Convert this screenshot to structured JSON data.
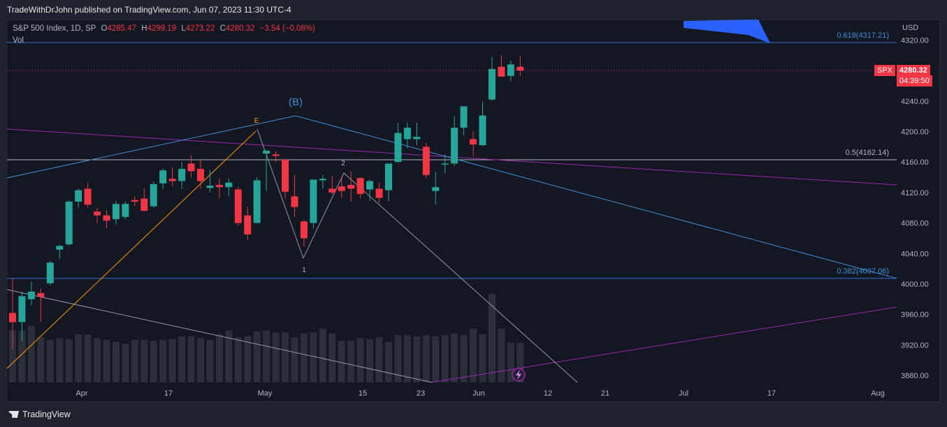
{
  "header": {
    "publish_line": "TradeWithDrJohn published on TradingView.com, Jun 07, 2023 11:30 UTC-4"
  },
  "legend": {
    "symbol": "S&P 500 Index, 1D, SP",
    "open_label": "O",
    "open": "4285.47",
    "high_label": "H",
    "high": "4299.19",
    "low_label": "L",
    "low": "4273.22",
    "close_label": "C",
    "close": "4280.32",
    "change": "−3.54 (−0.08%)",
    "volume_label": "Vol"
  },
  "price_axis": {
    "currency": "USD",
    "ticks": [
      "4320.00",
      "4240.00",
      "4200.00",
      "4160.00",
      "4120.00",
      "4080.00",
      "4040.00",
      "4000.00",
      "3960.00",
      "3920.00",
      "3880.00"
    ]
  },
  "time_axis": {
    "ticks": [
      "Apr",
      "17",
      "May",
      "15",
      "23",
      "Jun",
      "12",
      "21",
      "Jul",
      "17",
      "Aug"
    ]
  },
  "badges": {
    "symbol": "SPX",
    "last_price": "4280.32",
    "countdown": "04:39:50"
  },
  "annotations": {
    "fib_618": "0.618(4317.21)",
    "fib_5": "0.5(4162.14)",
    "fib_382": "0.382(4007.06)",
    "wave_b": "(B)",
    "wave_e": "E",
    "wave_1": "1",
    "wave_2": "2"
  },
  "footer": {
    "brand": "TradingView"
  },
  "colors": {
    "up": "#26a69a",
    "down": "#f23645",
    "background": "#131722",
    "fib_line": "#2962ff",
    "purple_line": "#9c27b0",
    "orange_line": "#ff9800"
  },
  "chart_data": {
    "type": "candlestick",
    "x_labels": [
      "Apr",
      "17",
      "May",
      "15",
      "23",
      "Jun",
      "12",
      "21",
      "Jul",
      "17",
      "Aug"
    ],
    "ylim": [
      3870,
      4330
    ],
    "candles": [
      {
        "o": 3962,
        "h": 4008,
        "l": 3915,
        "c": 3950
      },
      {
        "o": 3950,
        "h": 3990,
        "l": 3925,
        "c": 3984
      },
      {
        "o": 3980,
        "h": 4003,
        "l": 3972,
        "c": 3990
      },
      {
        "o": 3988,
        "h": 3994,
        "l": 3950,
        "c": 3983
      },
      {
        "o": 4001,
        "h": 4030,
        "l": 3998,
        "c": 4028
      },
      {
        "o": 4045,
        "h": 4052,
        "l": 4033,
        "c": 4050
      },
      {
        "o": 4052,
        "h": 4110,
        "l": 4050,
        "c": 4108
      },
      {
        "o": 4108,
        "h": 4125,
        "l": 4100,
        "c": 4123
      },
      {
        "o": 4125,
        "h": 4133,
        "l": 4100,
        "c": 4104
      },
      {
        "o": 4095,
        "h": 4100,
        "l": 4080,
        "c": 4090
      },
      {
        "o": 4090,
        "h": 4097,
        "l": 4073,
        "c": 4083
      },
      {
        "o": 4085,
        "h": 4109,
        "l": 4078,
        "c": 4105
      },
      {
        "o": 4088,
        "h": 4108,
        "l": 4085,
        "c": 4105
      },
      {
        "o": 4110,
        "h": 4115,
        "l": 4102,
        "c": 4108
      },
      {
        "o": 4112,
        "h": 4126,
        "l": 4095,
        "c": 4096
      },
      {
        "o": 4102,
        "h": 4134,
        "l": 4100,
        "c": 4131
      },
      {
        "o": 4132,
        "h": 4151,
        "l": 4125,
        "c": 4149
      },
      {
        "o": 4138,
        "h": 4153,
        "l": 4128,
        "c": 4135
      },
      {
        "o": 4135,
        "h": 4160,
        "l": 4125,
        "c": 4151
      },
      {
        "o": 4158,
        "h": 4169,
        "l": 4140,
        "c": 4148
      },
      {
        "o": 4151,
        "h": 4163,
        "l": 4125,
        "c": 4135
      },
      {
        "o": 4126,
        "h": 4150,
        "l": 4120,
        "c": 4129
      },
      {
        "o": 4130,
        "h": 4138,
        "l": 4112,
        "c": 4127
      },
      {
        "o": 4127,
        "h": 4138,
        "l": 4115,
        "c": 4133
      },
      {
        "o": 4124,
        "h": 4127,
        "l": 4076,
        "c": 4080
      },
      {
        "o": 4090,
        "h": 4101,
        "l": 4058,
        "c": 4065
      },
      {
        "o": 4080,
        "h": 4140,
        "l": 4080,
        "c": 4136
      },
      {
        "o": 4171,
        "h": 4173,
        "l": 4122,
        "c": 4175
      },
      {
        "o": 4170,
        "h": 4174,
        "l": 4160,
        "c": 4168
      },
      {
        "o": 4163,
        "h": 4164,
        "l": 4112,
        "c": 4121
      },
      {
        "o": 4115,
        "h": 4143,
        "l": 4088,
        "c": 4101
      },
      {
        "o": 4082,
        "h": 4084,
        "l": 4049,
        "c": 4060
      },
      {
        "o": 4080,
        "h": 4132,
        "l": 4073,
        "c": 4137
      },
      {
        "o": 4136,
        "h": 4143,
        "l": 4125,
        "c": 4138
      },
      {
        "o": 4125,
        "h": 4142,
        "l": 4117,
        "c": 4120
      },
      {
        "o": 4128,
        "h": 4140,
        "l": 4113,
        "c": 4122
      },
      {
        "o": 4130,
        "h": 4148,
        "l": 4108,
        "c": 4125
      },
      {
        "o": 4139,
        "h": 4140,
        "l": 4112,
        "c": 4118
      },
      {
        "o": 4124,
        "h": 4137,
        "l": 4109,
        "c": 4135
      },
      {
        "o": 4125,
        "h": 4133,
        "l": 4106,
        "c": 4113
      },
      {
        "o": 4123,
        "h": 4146,
        "l": 4109,
        "c": 4158
      },
      {
        "o": 4160,
        "h": 4211,
        "l": 4160,
        "c": 4198
      },
      {
        "o": 4190,
        "h": 4212,
        "l": 4178,
        "c": 4205
      },
      {
        "o": 4190,
        "h": 4212,
        "l": 4182,
        "c": 4193
      },
      {
        "o": 4180,
        "h": 4185,
        "l": 4139,
        "c": 4143
      },
      {
        "o": 4122,
        "h": 4147,
        "l": 4104,
        "c": 4127
      },
      {
        "o": 4157,
        "h": 4170,
        "l": 4145,
        "c": 4158
      },
      {
        "o": 4158,
        "h": 4220,
        "l": 4155,
        "c": 4205
      },
      {
        "o": 4205,
        "h": 4232,
        "l": 4195,
        "c": 4233
      },
      {
        "o": 4190,
        "h": 4200,
        "l": 4168,
        "c": 4183
      },
      {
        "o": 4182,
        "h": 4239,
        "l": 4181,
        "c": 4221
      },
      {
        "o": 4242,
        "h": 4298,
        "l": 4240,
        "c": 4282
      },
      {
        "o": 4285,
        "h": 4300,
        "l": 4280,
        "c": 4272
      },
      {
        "o": 4273,
        "h": 4293,
        "l": 4266,
        "c": 4288
      },
      {
        "o": 4285,
        "h": 4299,
        "l": 4273,
        "c": 4280
      }
    ],
    "volume_levels": [
      0.55,
      0.55,
      0.6,
      0.48,
      0.45,
      0.47,
      0.46,
      0.51,
      0.51,
      0.47,
      0.45,
      0.43,
      0.41,
      0.45,
      0.45,
      0.44,
      0.45,
      0.46,
      0.49,
      0.49,
      0.47,
      0.45,
      0.51,
      0.55,
      0.48,
      0.49,
      0.54,
      0.55,
      0.53,
      0.53,
      0.48,
      0.52,
      0.53,
      0.57,
      0.52,
      0.44,
      0.44,
      0.47,
      0.46,
      0.48,
      0.43,
      0.5,
      0.5,
      0.49,
      0.5,
      0.49,
      0.5,
      0.52,
      0.5,
      0.57,
      0.51,
      0.94,
      0.57,
      0.42,
      0.42
    ]
  }
}
